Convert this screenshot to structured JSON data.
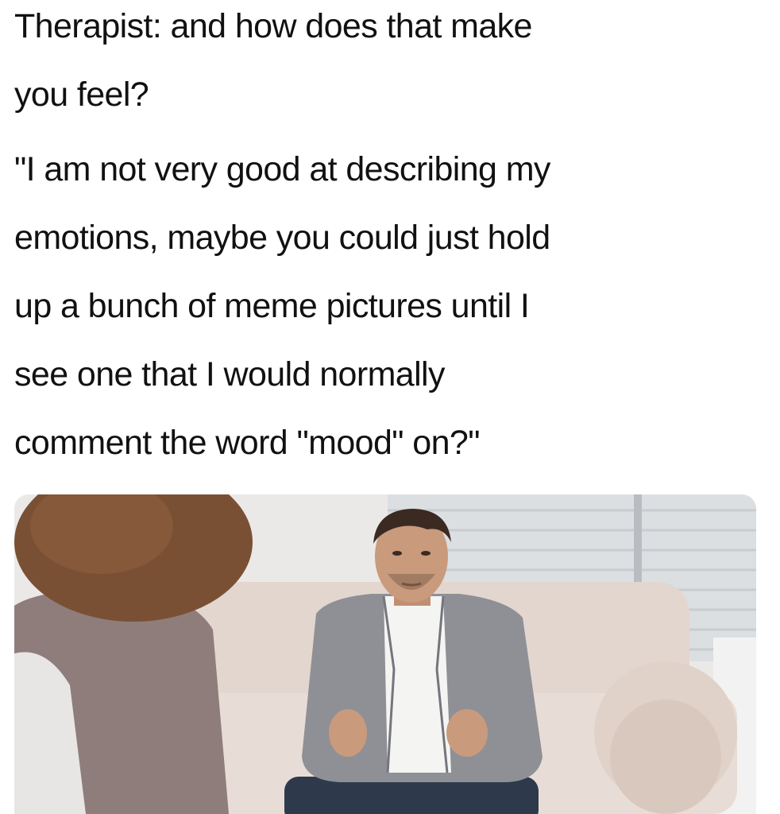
{
  "post": {
    "therapist_lines": [
      "Therapist: and how does that make",
      "you feel?"
    ],
    "reply_lines": [
      "\"I am not very good at describing my",
      "emotions, maybe you could just hold",
      "up a bunch of meme pictures until I",
      "see one that I would normally",
      "comment the word \"mood\" on?\""
    ]
  },
  "photo": {
    "subject": "man-on-couch-gesturing",
    "colors": {
      "background": "#eceaea",
      "couch": "#e8ddd6",
      "sweater": "#8e9096",
      "shirt": "#f4f4f2",
      "jeans": "#2e3a4c",
      "skin": "#c99a7c",
      "hair": "#3a2a22",
      "therapist_hair": "#7a5034",
      "therapist_top": "#8f7d7c"
    }
  }
}
